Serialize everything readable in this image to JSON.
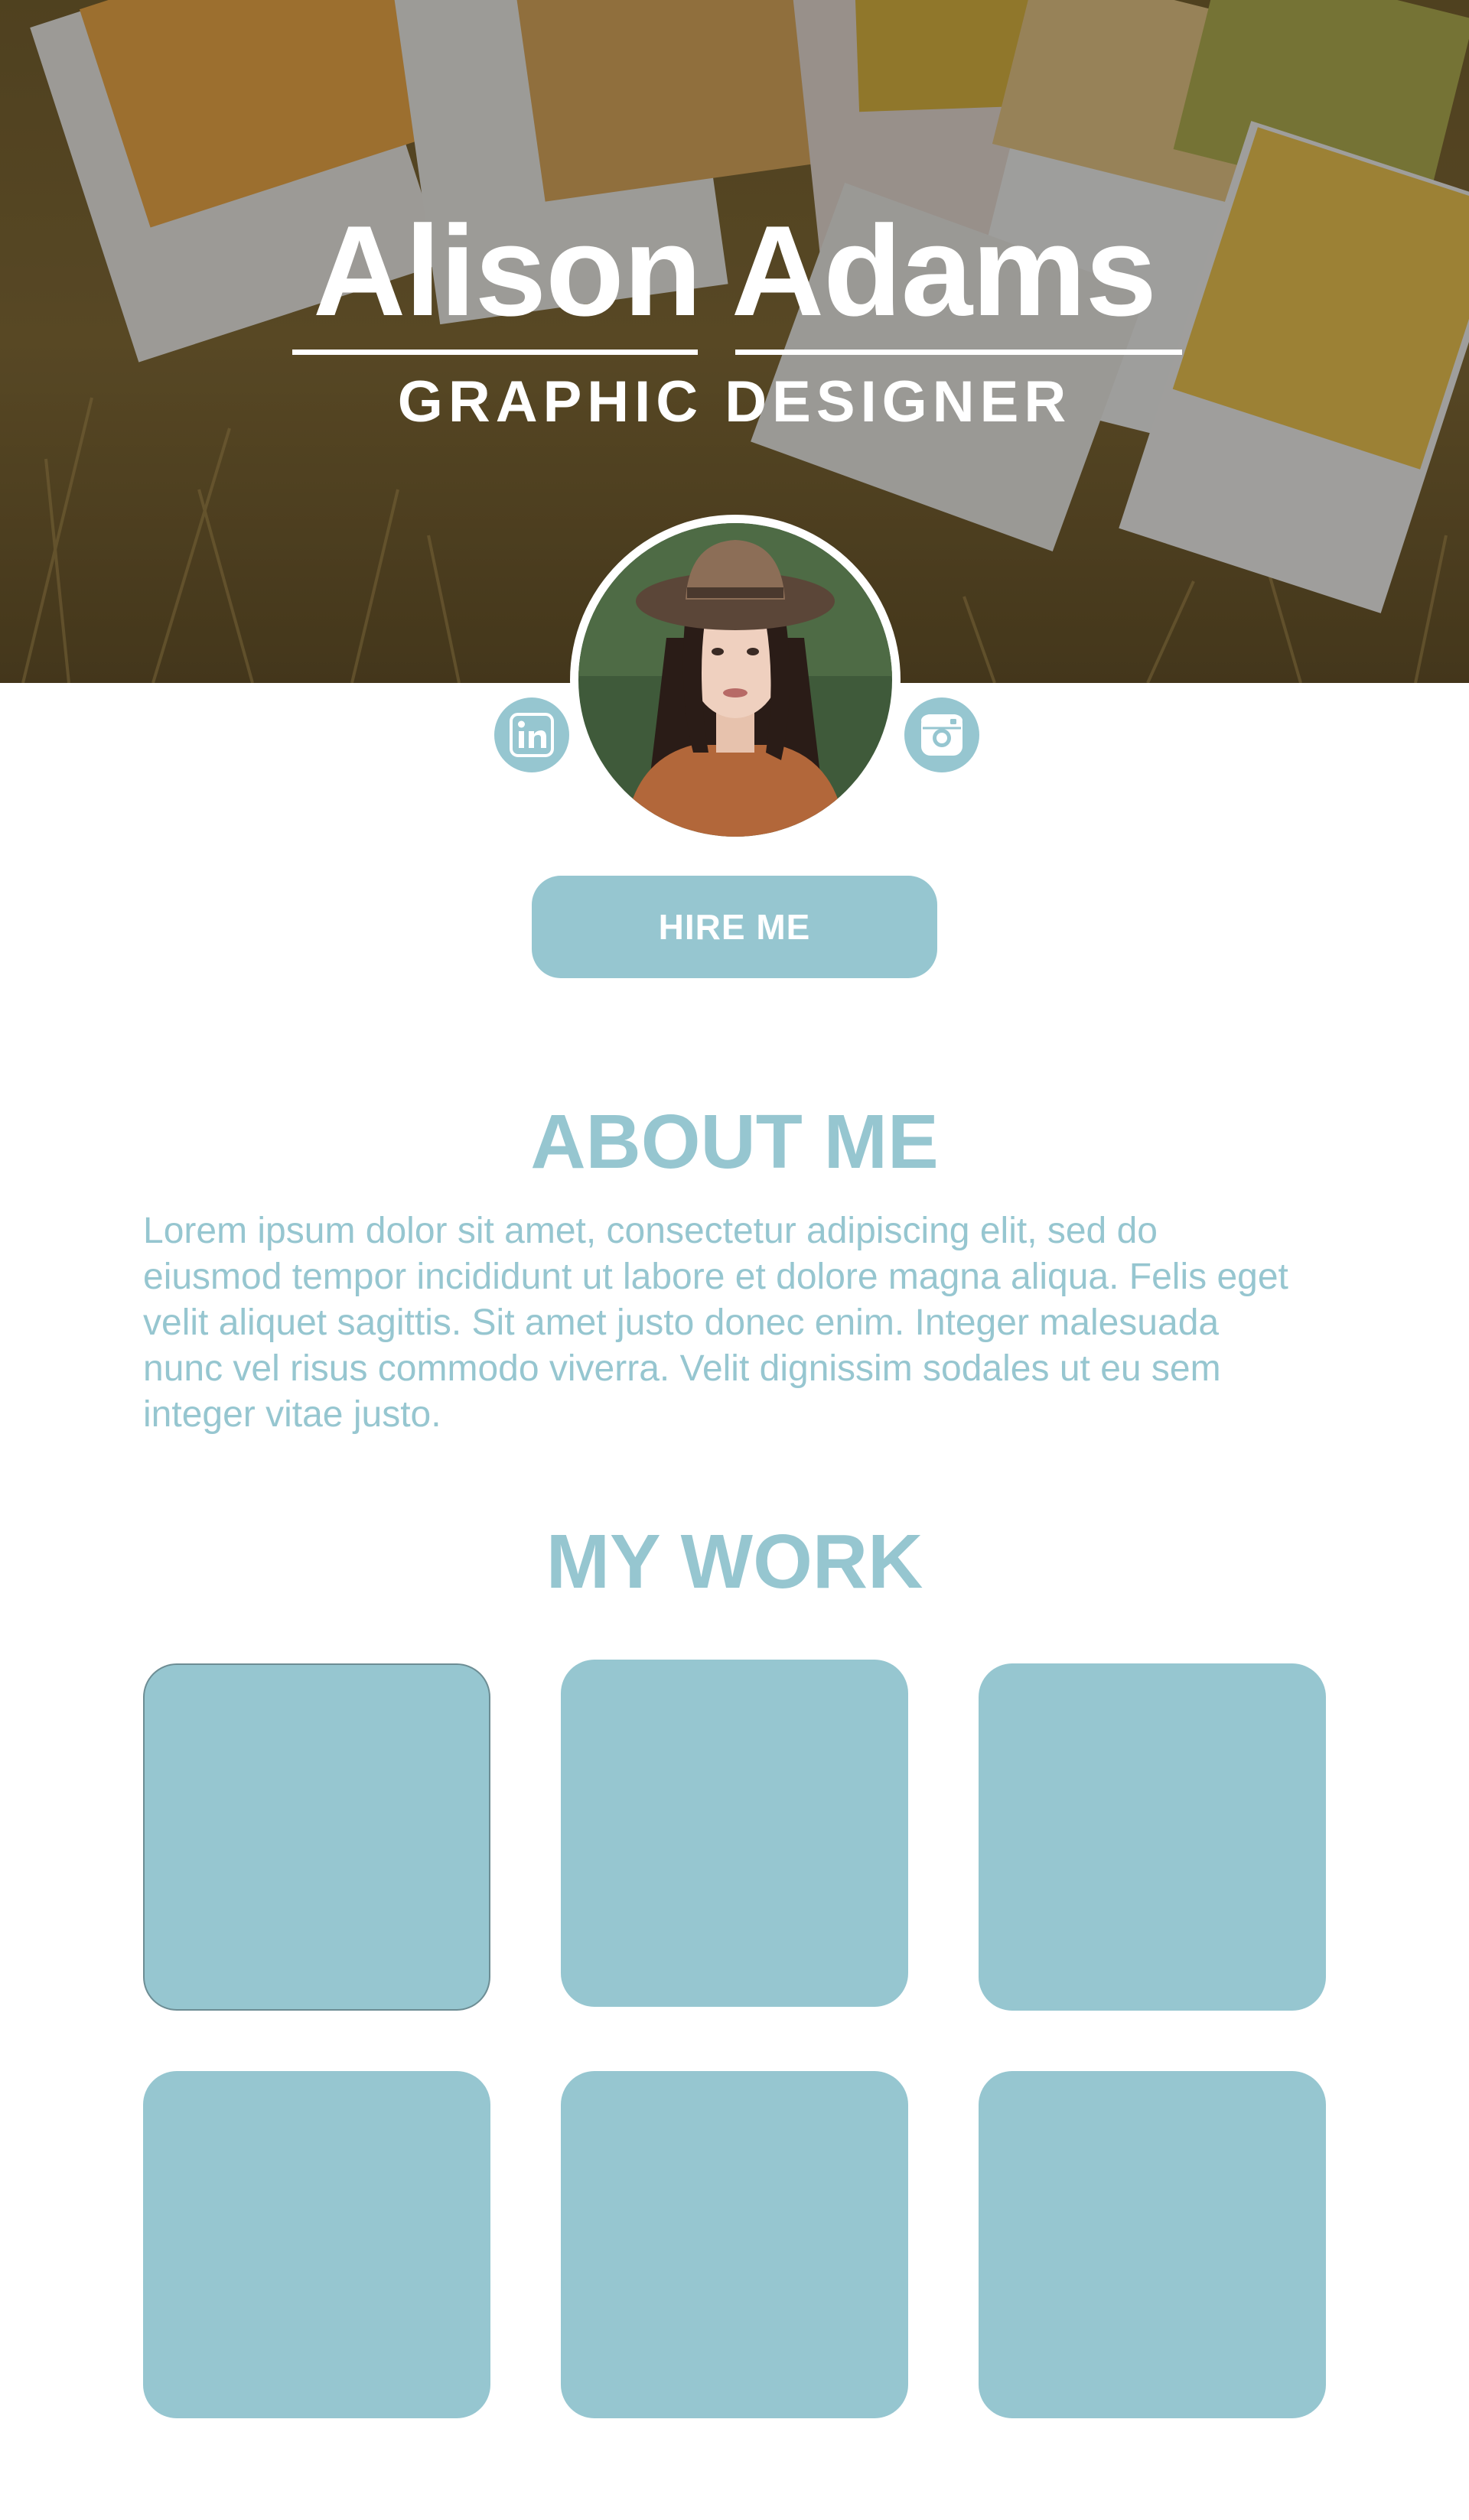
{
  "hero": {
    "name": "Alison Adams",
    "role": "GRAPHIC DESIGNER",
    "background": "pantone-swatches-on-grass-photo"
  },
  "profile": {
    "avatar": "portrait-woman-in-hat-photo",
    "social": [
      {
        "icon": "linkedin-icon"
      },
      {
        "icon": "instagram-icon"
      }
    ],
    "hire_label": "HIRE ME"
  },
  "about": {
    "heading": "ABOUT ME",
    "lines": [
      "Lorem ipsum dolor sit amet, consectetur adipiscing elit, sed do",
      "eiusmod tempor incididunt ut labore et dolore magna aliqua. Felis eget",
      "velit aliquet sagittis. Sit amet justo donec enim. Integer malesuada",
      "nunc vel risus commodo viverra. Velit dignissim sodales ut eu sem",
      "integer vitae justo."
    ]
  },
  "work": {
    "heading": "MY WORK",
    "tile_count": 6
  },
  "colors": {
    "accent": "#96c6d0",
    "text_on_accent": "#ffffff",
    "background": "#ffffff"
  }
}
